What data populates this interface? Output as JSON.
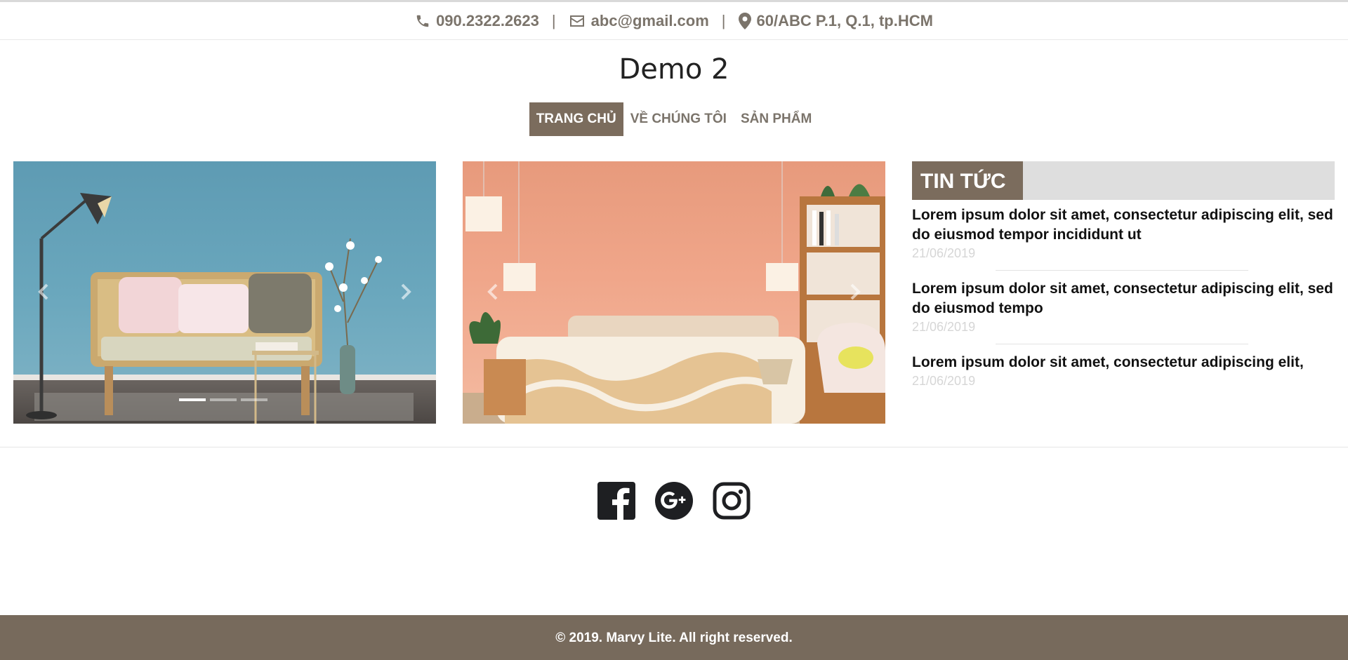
{
  "contact": {
    "phone": "090.2322.2623",
    "email": "abc@gmail.com",
    "address": "60/ABC P.1, Q.1, tp.HCM",
    "separator": "|"
  },
  "site": {
    "title": "Demo 2"
  },
  "nav": [
    {
      "label": "TRANG CHỦ",
      "active": true
    },
    {
      "label": "VỀ CHÚNG TÔI",
      "active": false
    },
    {
      "label": "SẢN PHẨM",
      "active": false
    }
  ],
  "slider": {
    "indicator_count": 3,
    "active_index": 0
  },
  "news": {
    "heading": "TIN TỨC",
    "items": [
      {
        "title": "Lorem ipsum dolor sit amet, consectetur adipiscing elit, sed do eiusmod tempor incididunt ut",
        "date": "21/06/2019"
      },
      {
        "title": "Lorem ipsum dolor sit amet, consectetur adipiscing elit, sed do eiusmod tempo",
        "date": "21/06/2019"
      },
      {
        "title": "Lorem ipsum dolor sit amet, consectetur adipiscing elit,",
        "date": "21/06/2019"
      }
    ]
  },
  "social": [
    "facebook-icon",
    "google-plus-icon",
    "instagram-icon"
  ],
  "footer": {
    "copyright": "© 2019. Marvy Lite. All right reserved."
  },
  "colors": {
    "brand": "#7b6c5d",
    "footer": "#776a5c",
    "muted_text": "#7b746b",
    "date": "#d6d6d6"
  }
}
